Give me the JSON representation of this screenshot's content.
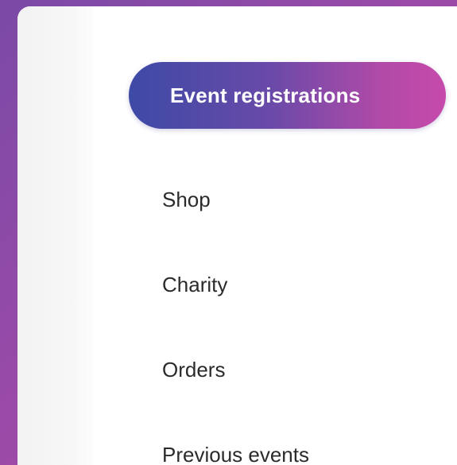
{
  "menu": {
    "active_item": "Event registrations",
    "items": [
      {
        "label": "Shop"
      },
      {
        "label": "Charity"
      },
      {
        "label": "Orders"
      },
      {
        "label": "Previous events"
      }
    ]
  },
  "colors": {
    "page_background_start": "#7a4aa6",
    "page_background_end": "#b24aa8",
    "active_pill_start": "#3d4aa6",
    "active_pill_end": "#c64aaa",
    "card_background": "#ffffff",
    "text": "#2b2b2b"
  }
}
